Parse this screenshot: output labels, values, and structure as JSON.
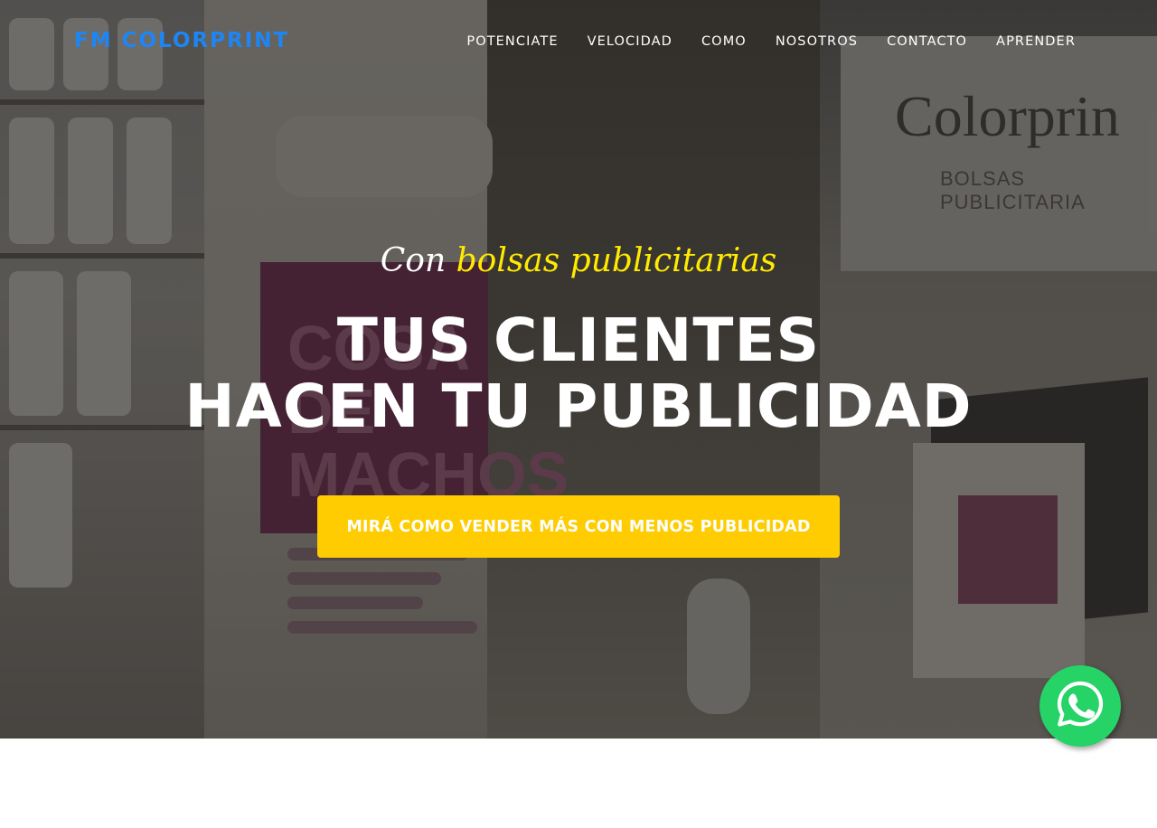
{
  "brand": {
    "name": "FM COLORPRINT",
    "color": "#1d86f4"
  },
  "nav": {
    "items": [
      {
        "label": "POTENCIATE"
      },
      {
        "label": "VELOCIDAD"
      },
      {
        "label": "COMO"
      },
      {
        "label": "NOSOTROS"
      },
      {
        "label": "CONTACTO"
      },
      {
        "label": "APRENDER"
      }
    ]
  },
  "hero": {
    "subtitle_prefix": "Con",
    "subtitle_highlight": "bolsas publicitarias",
    "headline_line1": "TUS CLIENTES",
    "headline_line2": "HACEN TU PUBLICIDAD",
    "cta_label": "MIRÁ COMO VENDER MÁS CON MENOS PUBLICIDAD",
    "highlight_color": "#ffea00",
    "cta_color": "#fecc00"
  },
  "background_photo": {
    "sign_text": "COSA DE MACHOS",
    "monitor_text": "Colorprin",
    "monitor_subtext": "BOLSAS PUBLICITARIA"
  },
  "whatsapp": {
    "icon": "whatsapp-icon",
    "color": "#25d366"
  }
}
